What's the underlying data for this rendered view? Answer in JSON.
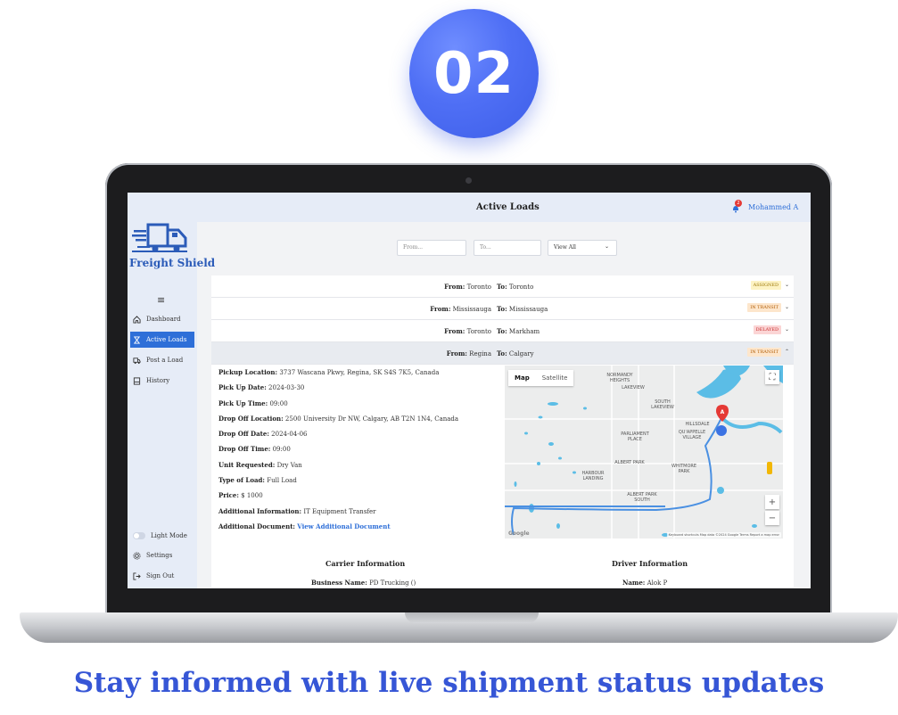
{
  "badge": {
    "number": "02"
  },
  "app": {
    "brand": "Freight Shield",
    "page_title": "Active Loads",
    "notification_count": "2",
    "user_name": "Mohammed A"
  },
  "sidebar": {
    "menu_icon": "hamburger-icon",
    "items": [
      {
        "label": "Dashboard",
        "icon": "home-icon",
        "active": false
      },
      {
        "label": "Active Loads",
        "icon": "hourglass-icon",
        "active": true
      },
      {
        "label": "Post a Load",
        "icon": "truck-icon",
        "active": false
      },
      {
        "label": "History",
        "icon": "clipboard-icon",
        "active": false
      }
    ],
    "bottom_items": [
      {
        "label": "Light Mode",
        "icon": "toggle-icon"
      },
      {
        "label": "Settings",
        "icon": "gear-icon"
      },
      {
        "label": "Sign Out",
        "icon": "sign-out-icon"
      }
    ]
  },
  "filters": {
    "from_placeholder": "From...",
    "to_placeholder": "To...",
    "view_value": "View All"
  },
  "loads": [
    {
      "from_label": "From:",
      "from": "Toronto",
      "to_label": "To:",
      "to": "Toronto",
      "status": "ASSIGNED",
      "status_bg": "#fdf3c4",
      "status_fg": "#9a7400",
      "expanded": false
    },
    {
      "from_label": "From:",
      "from": "Mississauga",
      "to_label": "To:",
      "to": "Mississauga",
      "status": "IN TRANSIT",
      "status_bg": "#fde6cc",
      "status_fg": "#b05a00",
      "expanded": false
    },
    {
      "from_label": "From:",
      "from": "Toronto",
      "to_label": "To:",
      "to": "Markham",
      "status": "DELAYED",
      "status_bg": "#fbd5d5",
      "status_fg": "#c62828",
      "expanded": false
    },
    {
      "from_label": "From:",
      "from": "Regina",
      "to_label": "To:",
      "to": "Calgary",
      "status": "IN TRANSIT",
      "status_bg": "#fde6cc",
      "status_fg": "#b05a00",
      "expanded": true
    }
  ],
  "details": [
    {
      "label": "Pickup Location:",
      "value": "3737 Wascana Pkwy, Regina, SK S4S 7K5, Canada"
    },
    {
      "label": "Pick Up Date:",
      "value": "2024-03-30"
    },
    {
      "label": "Pick Up Time:",
      "value": "09:00"
    },
    {
      "label": "Drop Off Location:",
      "value": "2500 University Dr NW, Calgary, AB T2N 1N4, Canada"
    },
    {
      "label": "Drop Off Date:",
      "value": "2024-04-06"
    },
    {
      "label": "Drop Off Time:",
      "value": "09:00"
    },
    {
      "label": "Unit Requested:",
      "value": "Dry Van"
    },
    {
      "label": "Type of Load:",
      "value": "Full Load"
    },
    {
      "label": "Price:",
      "value": "$ 1000"
    },
    {
      "label": "Additional Information:",
      "value": "IT Equipment Transfer"
    },
    {
      "label": "Additional Document:",
      "value": "View Additional Document"
    }
  ],
  "map": {
    "tab_map": "Map",
    "tab_satellite": "Satellite",
    "marker_label": "A",
    "labels": {
      "normandy": "NORMANDY HEIGHTS",
      "lakeview": "LAKEVIEW",
      "south_lakeview": "SOUTH LAKEVIEW",
      "hillsdale": "HILLSDALE",
      "quappelle": "QU'APPELLE VILLAGE",
      "parliament": "PARLIAMENT PLACE",
      "albert_park": "ALBERT PARK",
      "whitmore": "WHITMORE PARK",
      "harbour": "HARBOUR LANDING",
      "albert_south": "ALBERT PARK SOUTH"
    },
    "zoom_in": "+",
    "zoom_out": "−",
    "google_text": "Google",
    "footer": "Keyboard shortcuts   Map data ©2024 Google   Terms   Report a map error"
  },
  "carrier": {
    "title": "Carrier Information",
    "name_label": "Business Name:",
    "name": "PD Trucking ()"
  },
  "driver": {
    "title": "Driver Information",
    "name_label": "Name:",
    "name": "Alok P"
  },
  "tagline": "Stay informed with live shipment status updates"
}
